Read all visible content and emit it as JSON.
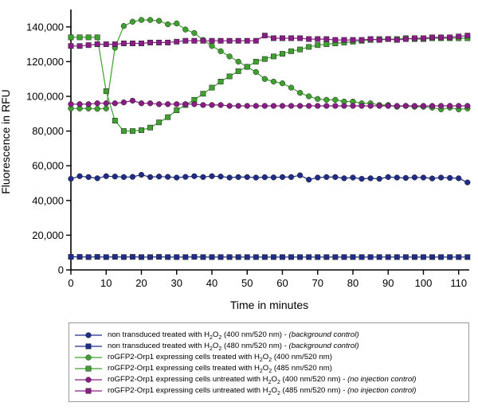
{
  "chart_data": {
    "type": "line",
    "title": "",
    "xlabel": "Time in minutes",
    "ylabel": "Fluorescence in RFU",
    "xlim": [
      0,
      113
    ],
    "ylim": [
      0,
      150000
    ],
    "x_ticks": [
      0,
      10,
      20,
      30,
      40,
      50,
      60,
      70,
      80,
      90,
      100,
      110
    ],
    "x_tick_labels": [
      "0",
      "10",
      "20",
      "30",
      "40",
      "50",
      "60",
      "70",
      "80",
      "90",
      "100",
      "110"
    ],
    "y_ticks": [
      0,
      20000,
      40000,
      60000,
      80000,
      100000,
      120000,
      140000
    ],
    "y_tick_labels": [
      "0",
      "20,000",
      "40,000",
      "60,000",
      "80,000",
      "100,000",
      "120,000",
      "140,000"
    ],
    "grid": false,
    "legend_position": "bottom",
    "x": [
      0,
      2.5,
      5,
      7.5,
      10,
      12.5,
      15,
      17.5,
      20,
      22.5,
      25,
      27.5,
      30,
      32.5,
      35,
      37.5,
      40,
      42.5,
      45,
      47.5,
      50,
      52.5,
      55,
      57.5,
      60,
      62.5,
      65,
      67.5,
      70,
      72.5,
      75,
      77.5,
      80,
      82.5,
      85,
      87.5,
      90,
      92.5,
      95,
      97.5,
      100,
      102.5,
      105,
      107.5,
      110,
      112.5
    ],
    "series": [
      {
        "name": "non transduced treated with H2O2 (400 nm/520 nm) - (background control)",
        "color": "#1f2d86",
        "marker": "circle",
        "values": [
          52500,
          54000,
          53500,
          52800,
          54000,
          53800,
          53500,
          53600,
          54800,
          53500,
          53800,
          53600,
          53200,
          53600,
          54000,
          53500,
          54000,
          53800,
          53200,
          53500,
          53500,
          53200,
          53400,
          53300,
          53500,
          53500,
          54500,
          52000,
          53200,
          53500,
          53500,
          52800,
          53200,
          52500,
          52800,
          52500,
          53500,
          53200,
          53000,
          53300,
          53200,
          52700,
          53200,
          53000,
          52800,
          50400
        ]
      },
      {
        "name": "non transduced treated with H2O2 (480 nm/520 nm) - (background control)",
        "color": "#1f2d86",
        "marker": "square",
        "values": [
          7500,
          7500,
          7400,
          7500,
          7400,
          7500,
          7400,
          7500,
          7400,
          7400,
          7500,
          7400,
          7400,
          7400,
          7500,
          7400,
          7400,
          7400,
          7400,
          7400,
          7400,
          7400,
          7400,
          7400,
          7400,
          7400,
          7400,
          7400,
          7400,
          7400,
          7400,
          7400,
          7400,
          7400,
          7400,
          7400,
          7400,
          7400,
          7400,
          7400,
          7400,
          7400,
          7400,
          7400,
          7400,
          7400
        ]
      },
      {
        "name": "roGFP2-Orp1 expressing cells treated with H2O2 (400 nm/520 nm)",
        "color": "#3ea02f",
        "marker": "circle",
        "values": [
          93000,
          93000,
          93000,
          92800,
          93000,
          128000,
          140500,
          143000,
          144000,
          144000,
          143500,
          141500,
          142000,
          138500,
          136500,
          132500,
          129000,
          126000,
          123000,
          120000,
          117000,
          114000,
          110000,
          108500,
          107500,
          105000,
          102000,
          100000,
          98500,
          98000,
          98000,
          97000,
          97000,
          96000,
          96000,
          95000,
          95000,
          94000,
          94500,
          94000,
          94000,
          93500,
          92500,
          93500,
          92500,
          93000
        ]
      },
      {
        "name": "roGFP2-Orp1 expressing cells treated with H2O2 (485 nm/520 nm)",
        "color": "#3ea02f",
        "marker": "square",
        "values": [
          134000,
          134000,
          134000,
          134000,
          103000,
          86000,
          80000,
          80000,
          80500,
          82000,
          85000,
          88000,
          92000,
          95000,
          98000,
          101500,
          105000,
          108500,
          111500,
          114500,
          117000,
          120000,
          121500,
          123000,
          124500,
          126000,
          127000,
          128500,
          129500,
          130000,
          130500,
          131000,
          131500,
          132000,
          132500,
          133000,
          133000,
          133000,
          133500,
          133000,
          133000,
          133500,
          133500,
          133500,
          133500,
          133500
        ]
      },
      {
        "name": "roGFP2-Orp1 expressing cells untreated with H2O2 (400 nm/520 nm) - (no injection control)",
        "color": "#8a1c86",
        "marker": "circle",
        "values": [
          95500,
          95500,
          95500,
          96000,
          96000,
          96000,
          96500,
          97500,
          96000,
          96000,
          95500,
          95500,
          95500,
          95500,
          95500,
          95000,
          95000,
          95000,
          94500,
          94500,
          94500,
          94500,
          94500,
          94500,
          94500,
          94500,
          94500,
          94500,
          94500,
          94500,
          94500,
          94500,
          94500,
          94500,
          94500,
          94500,
          94500,
          94500,
          94500,
          94500,
          94500,
          94500,
          94500,
          94500,
          94500,
          94500
        ]
      },
      {
        "name": "roGFP2-Orp1 expressing cells untreated with H2O2 (485 nm/520 nm) - (no injection control)",
        "color": "#8a1c86",
        "marker": "square",
        "values": [
          129000,
          129000,
          129500,
          130000,
          130000,
          130000,
          130500,
          130500,
          130500,
          131000,
          131000,
          131000,
          131500,
          132000,
          132000,
          132000,
          132000,
          132000,
          132000,
          132000,
          132000,
          132000,
          135000,
          133500,
          133500,
          133500,
          133500,
          133000,
          133000,
          133000,
          132500,
          132500,
          132500,
          132500,
          133000,
          132500,
          133000,
          132500,
          133000,
          133500,
          133500,
          134000,
          134000,
          134000,
          134500,
          135000
        ]
      }
    ]
  },
  "legend": {
    "items": [
      {
        "pre": "non transduced treated with H",
        "sub": "2",
        "mid": "O",
        "sub2": "2",
        "post": " (400 nm/520 nm) - ",
        "note": "(background control)"
      },
      {
        "pre": "non transduced treated with H",
        "sub": "2",
        "mid": "O",
        "sub2": "2",
        "post": " (480 nm/520 nm) - ",
        "note": "(background control)"
      },
      {
        "pre": "roGFP2-Orp1 expressing cells treated with H",
        "sub": "2",
        "mid": "O",
        "sub2": "2",
        "post": " (400 nm/520 nm)",
        "note": ""
      },
      {
        "pre": "roGFP2-Orp1 expressing cells treated with H",
        "sub": "2",
        "mid": "O",
        "sub2": "2",
        "post": " (485 nm/520 nm)",
        "note": ""
      },
      {
        "pre": "roGFP2-Orp1 expressing cells untreated with H",
        "sub": "2",
        "mid": "O",
        "sub2": "2",
        "post": " (400 nm/520 nm) - ",
        "note": "(no injection control)"
      },
      {
        "pre": "roGFP2-Orp1  expressing cells untreated with H",
        "sub": "2",
        "mid": "O",
        "sub2": "2",
        "post": " (485 nm/520 nm) - ",
        "note": "(no injection control)"
      }
    ]
  }
}
